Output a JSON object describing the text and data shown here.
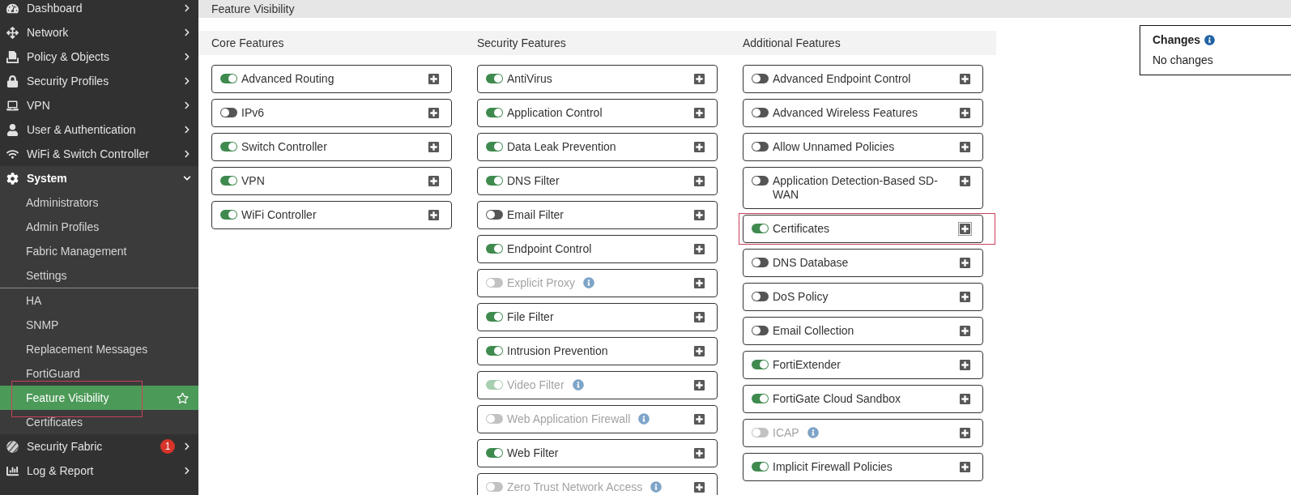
{
  "sidebar": {
    "items": [
      {
        "label": "Dashboard",
        "expanded": false
      },
      {
        "label": "Network",
        "expanded": false
      },
      {
        "label": "Policy & Objects",
        "expanded": false
      },
      {
        "label": "Security Profiles",
        "expanded": false
      },
      {
        "label": "VPN",
        "expanded": false
      },
      {
        "label": "User & Authentication",
        "expanded": false
      },
      {
        "label": "WiFi & Switch Controller",
        "expanded": false
      },
      {
        "label": "System",
        "expanded": true,
        "child_groups": [
          {
            "items": [
              {
                "label": "Administrators",
                "selected": false,
                "highlighted": false
              },
              {
                "label": "Admin Profiles",
                "selected": false,
                "highlighted": false
              },
              {
                "label": "Fabric Management",
                "selected": false,
                "highlighted": false
              },
              {
                "label": "Settings",
                "selected": false,
                "highlighted": false
              }
            ]
          },
          {
            "items": [
              {
                "label": "HA",
                "selected": false,
                "highlighted": false
              },
              {
                "label": "SNMP",
                "selected": false,
                "highlighted": false
              },
              {
                "label": "Replacement Messages",
                "selected": false,
                "highlighted": false
              },
              {
                "label": "FortiGuard",
                "selected": false,
                "highlighted": false
              },
              {
                "label": "Feature Visibility",
                "selected": true,
                "highlighted": true
              },
              {
                "label": "Certificates",
                "selected": false,
                "highlighted": false
              }
            ]
          }
        ]
      },
      {
        "label": "Security Fabric",
        "expanded": false,
        "badge": "1"
      },
      {
        "label": "Log & Report",
        "expanded": false
      }
    ]
  },
  "page_title": "Feature Visibility",
  "feature_columns": [
    {
      "heading": "Core Features",
      "features": [
        {
          "label": "Advanced Routing",
          "on": true,
          "disabled": false,
          "highlighted": false,
          "focused": false
        },
        {
          "label": "IPv6",
          "on": false,
          "disabled": false,
          "highlighted": false,
          "focused": false
        },
        {
          "label": "Switch Controller",
          "on": true,
          "disabled": false,
          "highlighted": false,
          "focused": false
        },
        {
          "label": "VPN",
          "on": true,
          "disabled": false,
          "highlighted": false,
          "focused": false
        },
        {
          "label": "WiFi Controller",
          "on": true,
          "disabled": false,
          "highlighted": false,
          "focused": false
        }
      ]
    },
    {
      "heading": "Security Features",
      "features": [
        {
          "label": "AntiVirus",
          "on": true,
          "disabled": false,
          "highlighted": false,
          "focused": false
        },
        {
          "label": "Application Control",
          "on": true,
          "disabled": false,
          "highlighted": false,
          "focused": false
        },
        {
          "label": "Data Leak Prevention",
          "on": true,
          "disabled": false,
          "highlighted": false,
          "focused": false
        },
        {
          "label": "DNS Filter",
          "on": true,
          "disabled": false,
          "highlighted": false,
          "focused": false
        },
        {
          "label": "Email Filter",
          "on": false,
          "disabled": false,
          "highlighted": false,
          "focused": false
        },
        {
          "label": "Endpoint Control",
          "on": true,
          "disabled": false,
          "highlighted": false,
          "focused": false
        },
        {
          "label": "Explicit Proxy",
          "on": false,
          "disabled": true,
          "highlighted": false,
          "focused": false
        },
        {
          "label": "File Filter",
          "on": true,
          "disabled": false,
          "highlighted": false,
          "focused": false
        },
        {
          "label": "Intrusion Prevention",
          "on": true,
          "disabled": false,
          "highlighted": false,
          "focused": false
        },
        {
          "label": "Video Filter",
          "on": true,
          "disabled": true,
          "highlighted": false,
          "focused": false
        },
        {
          "label": "Web Application Firewall",
          "on": false,
          "disabled": true,
          "highlighted": false,
          "focused": false
        },
        {
          "label": "Web Filter",
          "on": true,
          "disabled": false,
          "highlighted": false,
          "focused": false
        },
        {
          "label": "Zero Trust Network Access",
          "on": false,
          "disabled": true,
          "highlighted": false,
          "focused": false
        }
      ]
    },
    {
      "heading": "Additional Features",
      "features": [
        {
          "label": "Advanced Endpoint Control",
          "on": false,
          "disabled": false,
          "highlighted": false,
          "focused": false
        },
        {
          "label": "Advanced Wireless Features",
          "on": false,
          "disabled": false,
          "highlighted": false,
          "focused": false
        },
        {
          "label": "Allow Unnamed Policies",
          "on": false,
          "disabled": false,
          "highlighted": false,
          "focused": false
        },
        {
          "label": "Application Detection-Based SD-WAN",
          "on": false,
          "disabled": false,
          "highlighted": false,
          "focused": false
        },
        {
          "label": "Certificates",
          "on": true,
          "disabled": false,
          "highlighted": true,
          "focused": true
        },
        {
          "label": "DNS Database",
          "on": false,
          "disabled": false,
          "highlighted": false,
          "focused": false
        },
        {
          "label": "DoS Policy",
          "on": false,
          "disabled": false,
          "highlighted": false,
          "focused": false
        },
        {
          "label": "Email Collection",
          "on": false,
          "disabled": false,
          "highlighted": false,
          "focused": false
        },
        {
          "label": "FortiExtender",
          "on": true,
          "disabled": false,
          "highlighted": false,
          "focused": false
        },
        {
          "label": "FortiGate Cloud Sandbox",
          "on": true,
          "disabled": false,
          "highlighted": false,
          "focused": false
        },
        {
          "label": "ICAP",
          "on": false,
          "disabled": true,
          "highlighted": false,
          "focused": false
        },
        {
          "label": "Implicit Firewall Policies",
          "on": true,
          "disabled": false,
          "highlighted": false,
          "focused": false
        }
      ]
    }
  ],
  "changes": {
    "title": "Changes",
    "message": "No changes"
  }
}
